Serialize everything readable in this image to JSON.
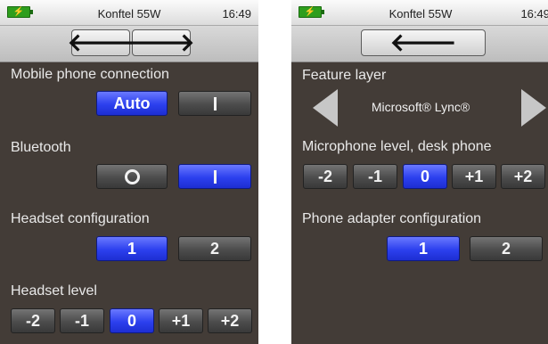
{
  "left": {
    "status": {
      "battery_icon": "battery-charging-icon",
      "title": "Konftel 55W",
      "time": "16:49"
    },
    "nav": {
      "back_icon": "arrow-left-icon",
      "forward_icon": "arrow-right-icon"
    },
    "mobile": {
      "label": "Mobile phone connection",
      "auto": "Auto",
      "on_icon": "on-bar-icon"
    },
    "bluetooth": {
      "label": "Bluetooth",
      "off_icon": "off-circle-icon",
      "on_icon": "on-bar-icon"
    },
    "headset_config": {
      "label": "Headset configuration",
      "opt1": "1",
      "opt2": "2"
    },
    "headset_level": {
      "label": "Headset level",
      "options": [
        "-2",
        "-1",
        "0",
        "+1",
        "+2"
      ],
      "selected": "0"
    }
  },
  "right": {
    "status": {
      "battery_icon": "battery-charging-icon",
      "title": "Konftel 55W",
      "time": "16:49"
    },
    "nav": {
      "back_icon": "arrow-left-icon"
    },
    "feature": {
      "label": "Feature layer",
      "value": "Microsoft® Lync®"
    },
    "mic": {
      "label": "Microphone level, desk phone",
      "options": [
        "-2",
        "-1",
        "0",
        "+1",
        "+2"
      ],
      "selected": "0"
    },
    "adapter": {
      "label": "Phone adapter configuration",
      "opt1": "1",
      "opt2": "2"
    }
  },
  "colors": {
    "screen_bg": "#433c37",
    "selected": "#3346f0",
    "unselected": "#4c4c4c",
    "label": "#e9e9e9"
  }
}
